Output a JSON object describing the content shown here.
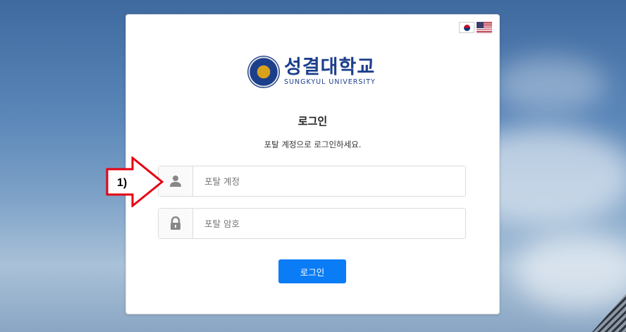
{
  "language_flags": [
    {
      "name": "Korean",
      "icon": "korea-flag-icon"
    },
    {
      "name": "English",
      "icon": "usa-flag-icon"
    }
  ],
  "logo": {
    "name_ko": "성결대학교",
    "name_en": "SUNGKYUL UNIVERSITY",
    "seal_text": "SUNGKYUL UNIVERSITY"
  },
  "login": {
    "title": "로그인",
    "subtitle": "포탈 계정으로 로그인하세요.",
    "id_placeholder": "포탈 계정",
    "pw_placeholder": "포탈 암호",
    "button_label": "로그인"
  },
  "annotation": {
    "label": "1)"
  },
  "colors": {
    "brand_blue": "#1c3f8c",
    "button_blue": "#0a7cf6",
    "annotation_red": "#e60012"
  }
}
